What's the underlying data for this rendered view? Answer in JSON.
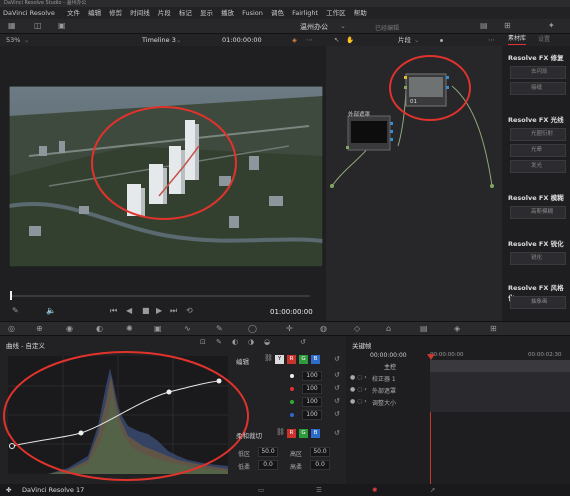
{
  "window_title": "DaVinci Resolve Studio - 温州办公",
  "menu": {
    "app": "DaVinci Resolve",
    "items": [
      "文件",
      "编辑",
      "修剪",
      "时间线",
      "片段",
      "标记",
      "显示",
      "播放",
      "Fusion",
      "调色",
      "Fairlight",
      "工作区",
      "帮助"
    ]
  },
  "project": {
    "name": "温州办公",
    "status": "已经编辑"
  },
  "viewer": {
    "zoom": "53%",
    "timeline": "Timeline 3",
    "timecode": "01:00:00:00",
    "current_tc": "01:00:00:00"
  },
  "nodes": {
    "clip_label": "片段",
    "node1_label": "01",
    "node2_label": "外部遮罩"
  },
  "right_panel": {
    "tabs": [
      "素材库",
      "设置"
    ],
    "groups": [
      {
        "title": "Resolve FX 修复",
        "buttons": [
          "去闪烁",
          "接缝"
        ]
      },
      {
        "title": "Resolve FX 光线",
        "buttons": [
          "光圈衍射",
          "光晕",
          "发光"
        ]
      },
      {
        "title": "Resolve FX 模糊",
        "buttons": [
          "高斯模糊"
        ]
      },
      {
        "title": "Resolve FX 锐化",
        "buttons": [
          "锐化"
        ]
      },
      {
        "title": "Resolve FX 风格化",
        "buttons": [
          "抽象画"
        ]
      }
    ]
  },
  "curves": {
    "title": "曲线 - 自定义",
    "edit_label": "编辑",
    "channel_y": "Y",
    "channel_r": "R",
    "channel_g": "G",
    "channel_b": "B",
    "values": [
      "100",
      "100",
      "100",
      "100"
    ],
    "soft_clip_label": "柔和裁切",
    "low_label": "低区",
    "low_value": "50.0",
    "high_label": "高区",
    "high_value": "50.0",
    "low_soft_label": "低柔",
    "low_soft_value": "0.0",
    "high_soft_label": "高柔",
    "high_soft_value": "0.0"
  },
  "keyframes": {
    "title": "关键帧",
    "tc_start": "00:00:00:00",
    "tc_ruler1": "00:00:00:00",
    "tc_ruler2": "00:00:02:30",
    "rows": [
      "主控",
      "校正器 1",
      "外部遮罩",
      "调整大小"
    ]
  },
  "status": {
    "app_name": "DaVinci Resolve 17"
  }
}
